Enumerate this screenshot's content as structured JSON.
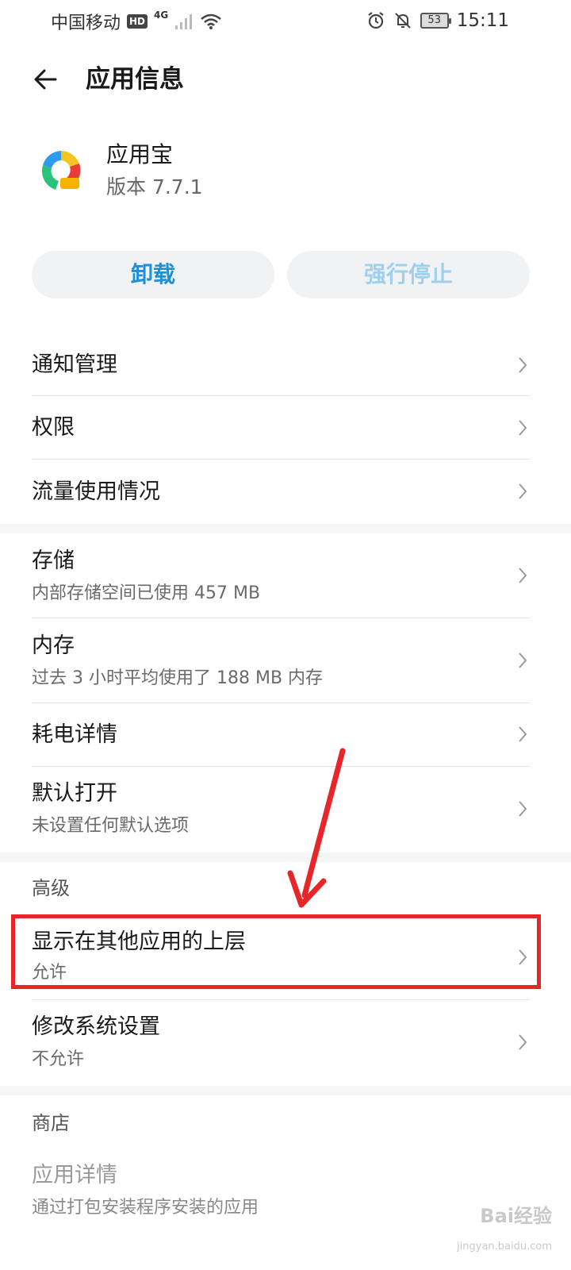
{
  "status_bar": {
    "carrier": "中国移动",
    "hd": "HD",
    "network": "4G",
    "battery": "53",
    "time": "15:11",
    "icons": [
      "signal-icon",
      "wifi-icon",
      "alarm-icon",
      "mute-icon",
      "battery-icon"
    ]
  },
  "header": {
    "title": "应用信息",
    "back_icon": "back-arrow-icon"
  },
  "app": {
    "name": "应用宝",
    "version": "版本 7.7.1"
  },
  "buttons": {
    "uninstall": "卸载",
    "force_stop": "强行停止"
  },
  "section1": [
    {
      "title": "通知管理"
    },
    {
      "title": "权限"
    },
    {
      "title": "流量使用情况"
    }
  ],
  "section2": [
    {
      "title": "存储",
      "subtitle": "内部存储空间已使用 457 MB"
    },
    {
      "title": "内存",
      "subtitle": "过去 3 小时平均使用了 188 MB 内存"
    },
    {
      "title": "耗电详情"
    },
    {
      "title": "默认打开",
      "subtitle": "未设置任何默认选项"
    }
  ],
  "advanced": {
    "header": "高级",
    "items": [
      {
        "title": "显示在其他应用的上层",
        "subtitle": "允许"
      },
      {
        "title": "修改系统设置",
        "subtitle": "不允许"
      }
    ]
  },
  "store": {
    "header": "商店",
    "items": [
      {
        "title": "应用详情",
        "subtitle": "通过打包安装程序安装的应用"
      }
    ]
  },
  "watermark": {
    "text": "Bai经验",
    "url": "jingyan.baidu.com"
  },
  "colors": {
    "accent": "#1e8fd8",
    "disabled": "#9fd0ee",
    "annotation": "#e8262a"
  }
}
